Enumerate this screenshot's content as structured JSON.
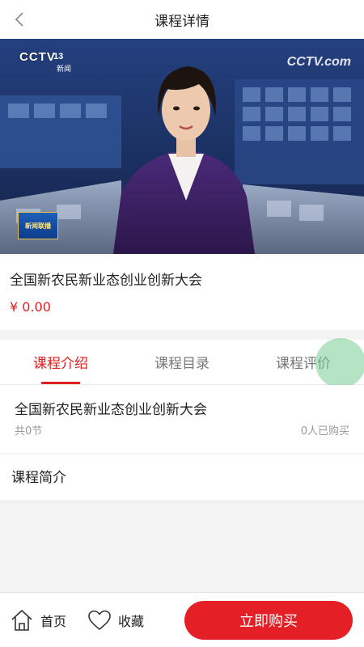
{
  "header": {
    "title": "课程详情",
    "back_icon": "chevron-left-icon"
  },
  "video": {
    "channel_logo": "CCTV",
    "channel_number": "13",
    "channel_sub": "新闻",
    "watermark": "CCTV.com",
    "program_badge": "新闻联播"
  },
  "course": {
    "title": "全国新农民新业态创业创新大会",
    "price": "¥ 0.00"
  },
  "tabs": [
    {
      "label": "课程介绍",
      "active": true
    },
    {
      "label": "课程目录",
      "active": false
    },
    {
      "label": "课程评价",
      "active": false
    }
  ],
  "section": {
    "title": "全国新农民新业态创业创新大会",
    "count": "共0节",
    "buyers": "0人已购买"
  },
  "intro": {
    "title": "课程简介"
  },
  "bottom_bar": {
    "home_label": "首页",
    "home_icon": "home-icon",
    "favorite_label": "收藏",
    "favorite_icon": "heart-icon",
    "buy_label": "立即购买"
  },
  "colors": {
    "accent": "#e02020",
    "buy_button": "#e41f25",
    "background": "#f3f3f3"
  }
}
